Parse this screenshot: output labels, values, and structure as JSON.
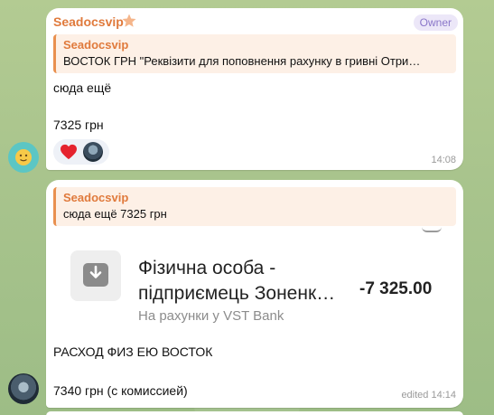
{
  "messages": [
    {
      "sender": "Seadocsvip",
      "badge": "Owner",
      "reply": {
        "name": "Seadocsvip",
        "text": "ВОСТОК ГРН \"Реквізити для поповнення рахунку в гривні Отри…"
      },
      "text_line1": "сюда ещё",
      "text_line2": "7325 грн",
      "time": "14:08",
      "reactions": [
        "heart-icon",
        "user-avatar"
      ]
    },
    {
      "reply": {
        "name": "Seadocsvip",
        "text": "сюда ещё 7325 грн"
      },
      "transaction": {
        "title_line1": "Фізична особа -",
        "title_line2": "підприємець Зоненк…",
        "subtitle": "На рахунки у VST Bank",
        "amount": "-7 325.00"
      },
      "text_line1": "РАСХОД ФИЗ ЕЮ ВОСТОК",
      "text_line2": "7340 грн (с комиссией)",
      "time": "edited 14:14"
    }
  ],
  "colors": {
    "sender": "#e07a3c",
    "owner_badge": "#8a76c9",
    "reply_bar": "#e9904f",
    "background": "#a9c48f"
  }
}
